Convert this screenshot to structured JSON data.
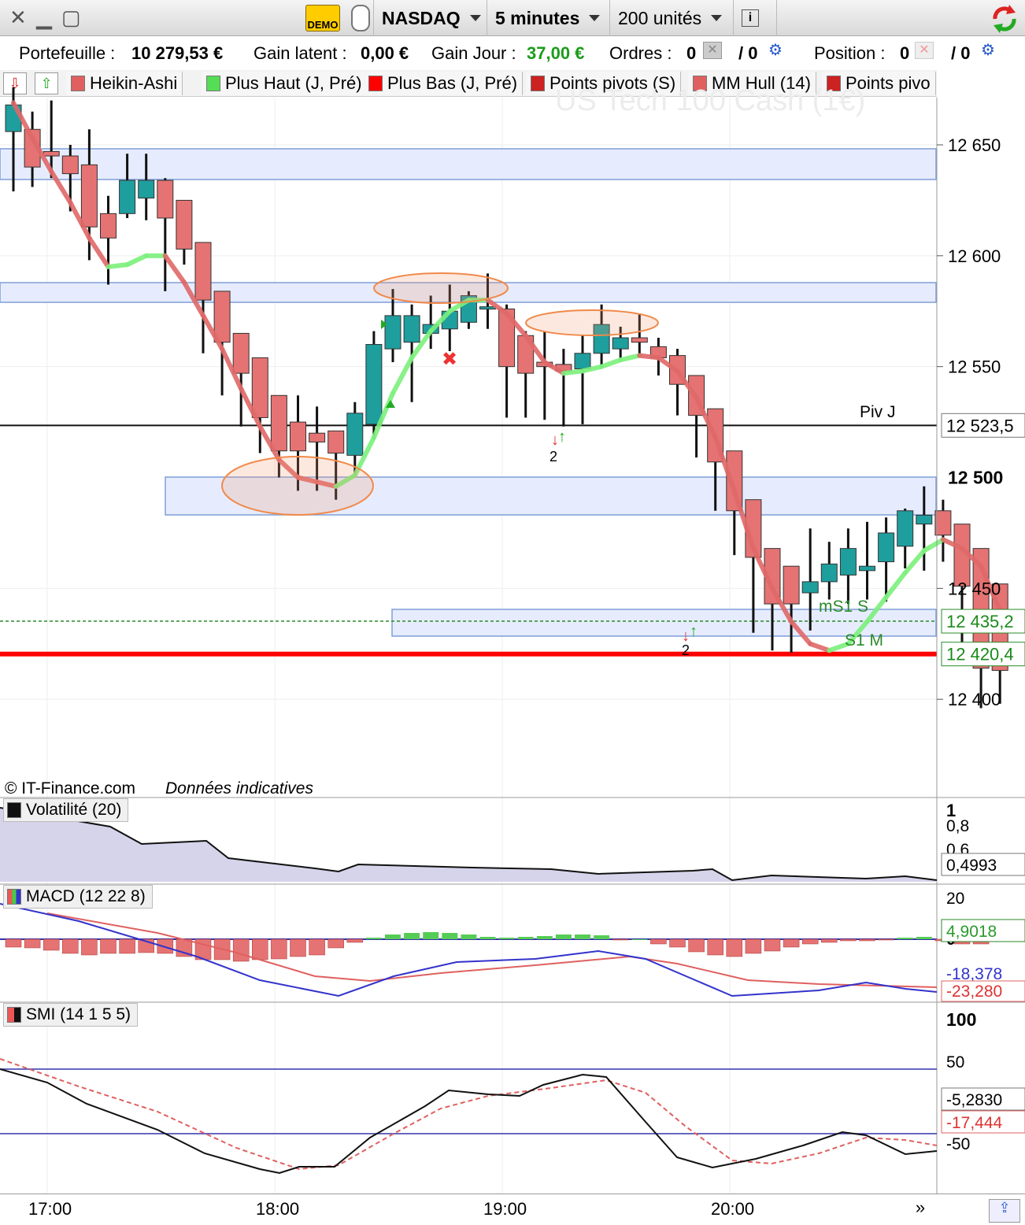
{
  "toolbar": {
    "symbol": "NASDAQ",
    "timeframe": "5 minutes",
    "units": "200 unités",
    "demo_badge": "DEMO",
    "info_icon": "info-icon"
  },
  "status": {
    "portfolio_label": "Portefeuille :",
    "portfolio_value": "10 279,53 €",
    "gain_latent_label": "Gain latent :",
    "gain_latent_value": "0,00 €",
    "gain_jour_label": "Gain Jour :",
    "gain_jour_value": "37,00 €",
    "ordres_label": "Ordres :",
    "ordres_value": "0",
    "ordres_slash": "/ 0",
    "position_label": "Position :",
    "position_value": "0",
    "position_slash": "/ 0"
  },
  "indicators": [
    {
      "label": "Heikin-Ashi",
      "color": "#e06060"
    },
    {
      "label": "Plus Haut (J, Pré)",
      "color": "#55dd55"
    },
    {
      "label": "Plus Bas (J, Pré)",
      "color": "#ff0000"
    },
    {
      "label": "Points pivots (S)",
      "color": "#cc2222"
    },
    {
      "label": "MM Hull (14)",
      "color": "#e06060"
    },
    {
      "label": "Points pivo",
      "color": "#cc2222"
    }
  ],
  "watermark": "US Tech 100 Cash (1€)",
  "copyright": "© IT-Finance.com",
  "disclaimer": "Données indicatives",
  "annotations": {
    "piv_j": "Piv J",
    "ms1": "mS1 S",
    "s1m": "S1 M",
    "count_a": "2",
    "count_b": "2"
  },
  "panels": {
    "volatility": {
      "label": "Volatilité (20)",
      "ticks": [
        "1",
        "0,8",
        "0,6"
      ],
      "last": "0,4993"
    },
    "macd": {
      "label": "MACD (12 22 8)",
      "ticks": [
        "20",
        "0"
      ],
      "value1": "4,9018",
      "value2": "-18,378",
      "value3": "-23,280"
    },
    "smi": {
      "label": "SMI (14 1 5 5)",
      "ticks": [
        "100",
        "50",
        "-50"
      ],
      "value1": "-5,2830",
      "value2": "-17,444"
    }
  },
  "price_tags": {
    "piv": "12 523,5",
    "high_level": "12 500",
    "green": "12 435,2",
    "red": "12 420,4"
  },
  "time_labels": [
    "17:00",
    "18:00",
    "19:00",
    "20:00"
  ],
  "colors": {
    "bull": "#1f9e9e",
    "bear": "#e57373",
    "hull_up": "#7cf07c",
    "hull_down": "#e06868",
    "zone": "#e6ecfd",
    "red_line": "#ff0000"
  },
  "chart_data": {
    "type": "candlestick",
    "y_ticks": [
      12650,
      12600,
      12550,
      12450,
      12400
    ],
    "ylim": [
      12376,
      12674
    ],
    "candles": [
      {
        "t": "16:55",
        "o": 12656,
        "h": 12676,
        "l": 12629,
        "c": 12668
      },
      {
        "t": "17:00",
        "o": 12657,
        "h": 12665,
        "l": 12631,
        "c": 12640
      },
      {
        "t": "17:05",
        "o": 12647,
        "h": 12670,
        "l": 12635,
        "c": 12645
      },
      {
        "t": "17:10",
        "o": 12645,
        "h": 12650,
        "l": 12620,
        "c": 12637
      },
      {
        "t": "17:15",
        "o": 12641,
        "h": 12657,
        "l": 12598,
        "c": 12613
      },
      {
        "t": "17:20",
        "o": 12619,
        "h": 12627,
        "l": 12587,
        "c": 12608
      },
      {
        "t": "17:25",
        "o": 12619,
        "h": 12646,
        "l": 12617,
        "c": 12634
      },
      {
        "t": "17:30",
        "o": 12626,
        "h": 12646,
        "l": 12616,
        "c": 12634
      },
      {
        "t": "17:35",
        "o": 12634,
        "h": 12635,
        "l": 12584,
        "c": 12617
      },
      {
        "t": "17:40",
        "o": 12625,
        "h": 12625,
        "l": 12596,
        "c": 12603
      },
      {
        "t": "17:45",
        "o": 12606,
        "h": 12606,
        "l": 12556,
        "c": 12580
      },
      {
        "t": "17:50",
        "o": 12584,
        "h": 12584,
        "l": 12537,
        "c": 12561
      },
      {
        "t": "17:55",
        "o": 12565,
        "h": 12565,
        "l": 12523,
        "c": 12547
      },
      {
        "t": "18:00",
        "o": 12554,
        "h": 12554,
        "l": 12511,
        "c": 12527
      },
      {
        "t": "18:05",
        "o": 12537,
        "h": 12537,
        "l": 12500,
        "c": 12512
      },
      {
        "t": "18:10",
        "o": 12525,
        "h": 12537,
        "l": 12494,
        "c": 12512
      },
      {
        "t": "18:15",
        "o": 12520,
        "h": 12532,
        "l": 12494,
        "c": 12516
      },
      {
        "t": "18:20",
        "o": 12521,
        "h": 12521,
        "l": 12490,
        "c": 12511
      },
      {
        "t": "18:25",
        "o": 12510,
        "h": 12534,
        "l": 12500,
        "c": 12529
      },
      {
        "t": "18:30",
        "o": 12524,
        "h": 12566,
        "l": 12517,
        "c": 12560
      },
      {
        "t": "18:35",
        "o": 12558,
        "h": 12585,
        "l": 12552,
        "c": 12573
      },
      {
        "t": "18:40",
        "o": 12561,
        "h": 12578,
        "l": 12534,
        "c": 12573
      },
      {
        "t": "18:45",
        "o": 12565,
        "h": 12582,
        "l": 12558,
        "c": 12569
      },
      {
        "t": "18:50",
        "o": 12567,
        "h": 12587,
        "l": 12557,
        "c": 12575
      },
      {
        "t": "18:55",
        "o": 12570,
        "h": 12584,
        "l": 12567,
        "c": 12582
      },
      {
        "t": "19:00",
        "o": 12576,
        "h": 12592,
        "l": 12567,
        "c": 12577
      },
      {
        "t": "19:05",
        "o": 12576,
        "h": 12578,
        "l": 12527,
        "c": 12550
      },
      {
        "t": "19:10",
        "o": 12564,
        "h": 12566,
        "l": 12527,
        "c": 12547
      },
      {
        "t": "19:15",
        "o": 12552,
        "h": 12566,
        "l": 12526,
        "c": 12550
      },
      {
        "t": "19:20",
        "o": 12551,
        "h": 12558,
        "l": 12523,
        "c": 12548
      },
      {
        "t": "19:25",
        "o": 12549,
        "h": 12564,
        "l": 12524,
        "c": 12556
      },
      {
        "t": "19:30",
        "o": 12556,
        "h": 12578,
        "l": 12549,
        "c": 12569
      },
      {
        "t": "19:35",
        "o": 12558,
        "h": 12568,
        "l": 12554,
        "c": 12563
      },
      {
        "t": "19:40",
        "o": 12563,
        "h": 12574,
        "l": 12554,
        "c": 12561
      },
      {
        "t": "19:45",
        "o": 12559,
        "h": 12563,
        "l": 12546,
        "c": 12554
      },
      {
        "t": "19:50",
        "o": 12555,
        "h": 12558,
        "l": 12528,
        "c": 12542
      },
      {
        "t": "19:55",
        "o": 12546,
        "h": 12546,
        "l": 12509,
        "c": 12528
      },
      {
        "t": "20:00",
        "o": 12531,
        "h": 12531,
        "l": 12485,
        "c": 12507
      },
      {
        "t": "20:05",
        "o": 12512,
        "h": 12512,
        "l": 12465,
        "c": 12485
      },
      {
        "t": "20:10",
        "o": 12490,
        "h": 12490,
        "l": 12430,
        "c": 12464
      },
      {
        "t": "20:15",
        "o": 12468,
        "h": 12468,
        "l": 12422,
        "c": 12443
      },
      {
        "t": "20:20",
        "o": 12460,
        "h": 12460,
        "l": 12421,
        "c": 12443
      },
      {
        "t": "20:25",
        "o": 12448,
        "h": 12477,
        "l": 12431,
        "c": 12453
      },
      {
        "t": "20:30",
        "o": 12453,
        "h": 12471,
        "l": 12445,
        "c": 12461
      },
      {
        "t": "20:35",
        "o": 12456,
        "h": 12477,
        "l": 12443,
        "c": 12468
      },
      {
        "t": "20:40",
        "o": 12458,
        "h": 12480,
        "l": 12445,
        "c": 12460
      },
      {
        "t": "20:45",
        "o": 12462,
        "h": 12482,
        "l": 12444,
        "c": 12475
      },
      {
        "t": "20:50",
        "o": 12469,
        "h": 12486,
        "l": 12459,
        "c": 12485
      },
      {
        "t": "20:55",
        "o": 12479,
        "h": 12496,
        "l": 12458,
        "c": 12483
      },
      {
        "t": "21:00",
        "o": 12485,
        "h": 12490,
        "l": 12462,
        "c": 12474
      },
      {
        "t": "21:05",
        "o": 12479,
        "h": 12479,
        "l": 12420,
        "c": 12451
      },
      {
        "t": "21:10",
        "o": 12468,
        "h": 12468,
        "l": 12396,
        "c": 12414
      },
      {
        "t": "21:15",
        "o": 12452,
        "h": 12452,
        "l": 12398,
        "c": 12413
      }
    ],
    "hull_ma": [
      12669,
      12653,
      12638,
      12624,
      12608,
      12595,
      12596,
      12600,
      12600,
      12588,
      12573,
      12558,
      12540,
      12523,
      12508,
      12500,
      12498,
      12496,
      12501,
      12518,
      12538,
      12554,
      12566,
      12575,
      12580,
      12580,
      12574,
      12564,
      12552,
      12547,
      12548,
      12550,
      12553,
      12555,
      12554,
      12548,
      12536,
      12518,
      12494,
      12468,
      12450,
      12435,
      12425,
      12422,
      12425,
      12435,
      12446,
      12457,
      12467,
      12472,
      12468,
      12460,
      12440
    ],
    "levels": {
      "piv_j": 12523.5,
      "plus_bas": 12420.4,
      "s1": 12435.2
    }
  }
}
